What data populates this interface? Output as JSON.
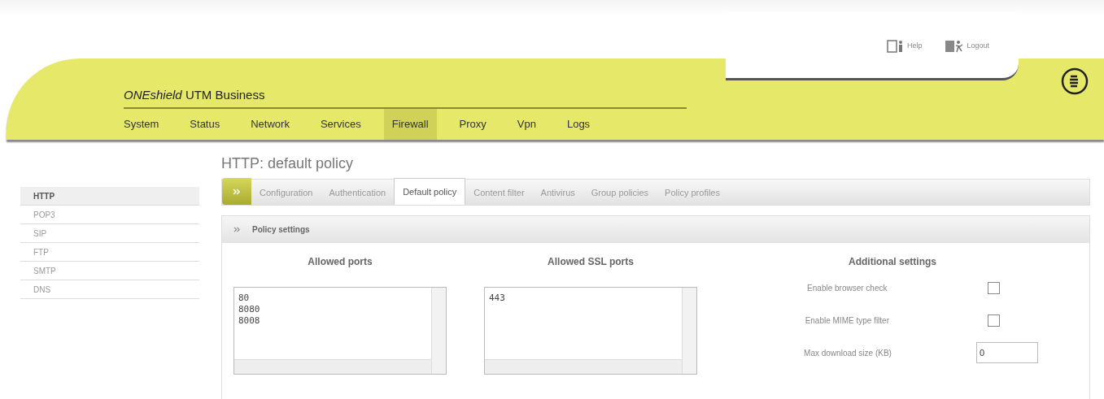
{
  "header": {
    "product_italic": "ONEshield",
    "product": "UTM Business",
    "links": [
      {
        "kind": "help",
        "label": "Help"
      },
      {
        "kind": "logout",
        "label": "Logout"
      }
    ]
  },
  "menu": [
    {
      "label": "System",
      "selected": false
    },
    {
      "label": "Status",
      "selected": false
    },
    {
      "label": "Network",
      "selected": false
    },
    {
      "label": "Services",
      "selected": false
    },
    {
      "label": "Firewall",
      "selected": true
    },
    {
      "label": "Proxy",
      "selected": false
    },
    {
      "label": "Vpn",
      "selected": false
    },
    {
      "label": "Logs",
      "selected": false
    }
  ],
  "page_title": "HTTP: default policy",
  "sidebar": {
    "items": [
      {
        "label": "HTTP",
        "selected": true
      },
      {
        "label": "POP3",
        "selected": false
      },
      {
        "label": "SIP",
        "selected": false
      },
      {
        "label": "FTP",
        "selected": false
      },
      {
        "label": "SMTP",
        "selected": false
      },
      {
        "label": "DNS",
        "selected": false
      }
    ]
  },
  "tabs": [
    {
      "label": "Configuration",
      "selected": false
    },
    {
      "label": "Authentication",
      "selected": false
    },
    {
      "label": "Default policy",
      "selected": true
    },
    {
      "label": "Content filter",
      "selected": false
    },
    {
      "label": "Antivirus",
      "selected": false
    },
    {
      "label": "Group policies",
      "selected": false
    },
    {
      "label": "Policy profiles",
      "selected": false
    }
  ],
  "panel": {
    "title": "Policy settings",
    "allowed_ports": {
      "heading": "Allowed ports",
      "lines": [
        "80",
        "8080",
        "8008"
      ]
    },
    "allowed_ssl_ports": {
      "heading": "Allowed SSL ports",
      "lines": [
        "443"
      ]
    },
    "additional": {
      "heading": "Additional settings",
      "rows": [
        {
          "kind": "checkbox",
          "label": "Enable browser check",
          "checked": false
        },
        {
          "kind": "checkbox",
          "label": "Enable MIME type filter",
          "checked": false
        },
        {
          "kind": "input",
          "label": "Max download size (KB)",
          "value": "0"
        }
      ]
    }
  }
}
